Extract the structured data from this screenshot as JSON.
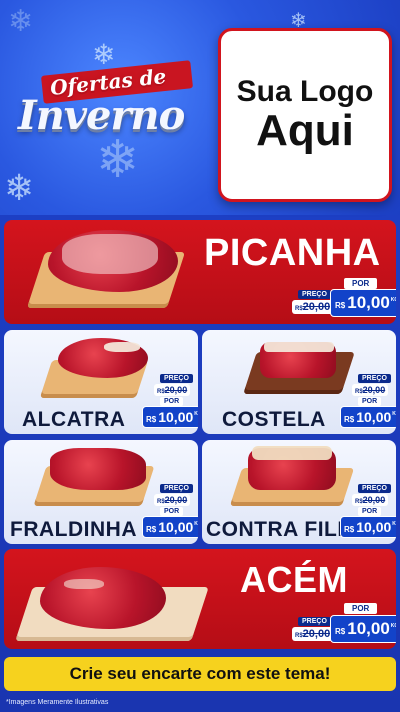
{
  "header": {
    "title_small": "Ofertas de",
    "title_big": "Inverno",
    "logo_line1": "Sua Logo",
    "logo_line2": "Aqui"
  },
  "products": [
    {
      "name": "PICANHA",
      "price_label": "PREÇO",
      "old_prefix": "R$",
      "old_price": "20,00",
      "por_label": "POR",
      "currency": "R$",
      "new_price": "10,00",
      "unit": "KG"
    },
    {
      "name": "ALCATRA",
      "price_label": "PREÇO",
      "old_prefix": "R$",
      "old_price": "20,00",
      "por_label": "POR",
      "currency": "R$",
      "new_price": "10,00",
      "unit": "KG"
    },
    {
      "name": "COSTELA",
      "price_label": "PREÇO",
      "old_prefix": "R$",
      "old_price": "20,00",
      "por_label": "POR",
      "currency": "R$",
      "new_price": "10,00",
      "unit": "KG"
    },
    {
      "name": "FRALDINHA",
      "price_label": "PREÇO",
      "old_prefix": "R$",
      "old_price": "20,00",
      "por_label": "POR",
      "currency": "R$",
      "new_price": "10,00",
      "unit": "KG"
    },
    {
      "name": "CONTRA FILÉ",
      "price_label": "PREÇO",
      "old_prefix": "R$",
      "old_price": "20,00",
      "por_label": "POR",
      "currency": "R$",
      "new_price": "10,00",
      "unit": "KG"
    },
    {
      "name": "ACÉM",
      "price_label": "PREÇO",
      "old_prefix": "R$",
      "old_price": "20,00",
      "por_label": "POR",
      "currency": "R$",
      "new_price": "10,00",
      "unit": "KG"
    }
  ],
  "footer": {
    "cta": "Crie seu encarte com este tema!",
    "disclaimer": "*Imagens Meramente Ilustrativas"
  },
  "colors": {
    "background": "#1d3fc4",
    "card_red": "#c9121c",
    "card_light": "#eef2fc",
    "price_blue": "#1243c9",
    "cta_yellow": "#f6d21e"
  },
  "icons": [
    "snowflake-icon"
  ]
}
